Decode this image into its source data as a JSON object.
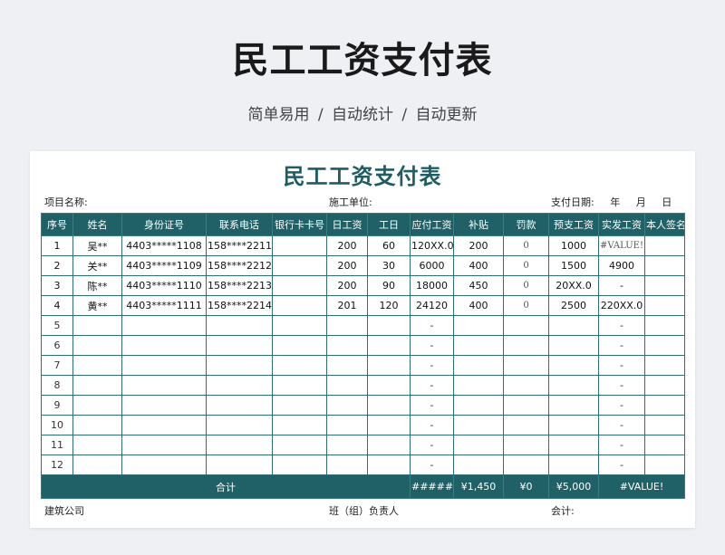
{
  "page": {
    "title": "民工工资支付表",
    "subtitle": "简单易用 / 自动统计 / 自动更新"
  },
  "sheet": {
    "title": "民工工资支付表",
    "project_label": "项目名称:",
    "unit_label": "施工单位:",
    "date_label": "支付日期:",
    "date_year": "年",
    "date_month": "月",
    "date_day": "日",
    "headers": [
      "序号",
      "姓名",
      "身份证号",
      "联系电话",
      "银行卡卡号",
      "日工资",
      "工日",
      "应付工资",
      "补贴",
      "罚款",
      "预支工资",
      "实发工资",
      "本人签名"
    ],
    "rows": [
      {
        "no": "1",
        "name": "吴**",
        "id": "4403*****1108",
        "phone": "158****2211",
        "bank": "",
        "daily": "200",
        "days": "60",
        "payable": "120XX.0",
        "subsidy": "200",
        "fine": "0",
        "advance": "1000",
        "actual": "#VALUE!",
        "sign": ""
      },
      {
        "no": "2",
        "name": "关**",
        "id": "4403*****1109",
        "phone": "158****2212",
        "bank": "",
        "daily": "200",
        "days": "30",
        "payable": "6000",
        "subsidy": "400",
        "fine": "0",
        "advance": "1500",
        "actual": "4900",
        "sign": ""
      },
      {
        "no": "3",
        "name": "陈**",
        "id": "4403*****1110",
        "phone": "158****2213",
        "bank": "",
        "daily": "200",
        "days": "90",
        "payable": "18000",
        "subsidy": "450",
        "fine": "0",
        "advance": "20XX.0",
        "actual": "-",
        "sign": ""
      },
      {
        "no": "4",
        "name": "黄**",
        "id": "4403*****1111",
        "phone": "158****2214",
        "bank": "",
        "daily": "201",
        "days": "120",
        "payable": "24120",
        "subsidy": "400",
        "fine": "0",
        "advance": "2500",
        "actual": "220XX.0",
        "sign": ""
      }
    ],
    "empty_rows": [
      {
        "no": "5",
        "payable": "-",
        "actual": "-"
      },
      {
        "no": "6",
        "payable": "-",
        "actual": "-"
      },
      {
        "no": "7",
        "payable": "-",
        "actual": "-"
      },
      {
        "no": "8",
        "payable": "-",
        "actual": "-"
      },
      {
        "no": "9",
        "payable": "-",
        "actual": "-"
      },
      {
        "no": "10",
        "payable": "-",
        "actual": "-"
      },
      {
        "no": "11",
        "payable": "-",
        "actual": "-"
      },
      {
        "no": "12",
        "payable": "-",
        "actual": "-"
      }
    ],
    "totals": {
      "label": "合计",
      "payable": "######",
      "subsidy": "¥1,450",
      "fine": "¥0",
      "advance": "¥5,000",
      "actual": "#VALUE!"
    },
    "footer": {
      "company": "建筑公司",
      "leader": "班（组）负责人",
      "accountant": "会计:"
    }
  },
  "colors": {
    "header_bg": "#1f6166",
    "title_color": "#1e5d63",
    "border": "#2d6f72"
  }
}
